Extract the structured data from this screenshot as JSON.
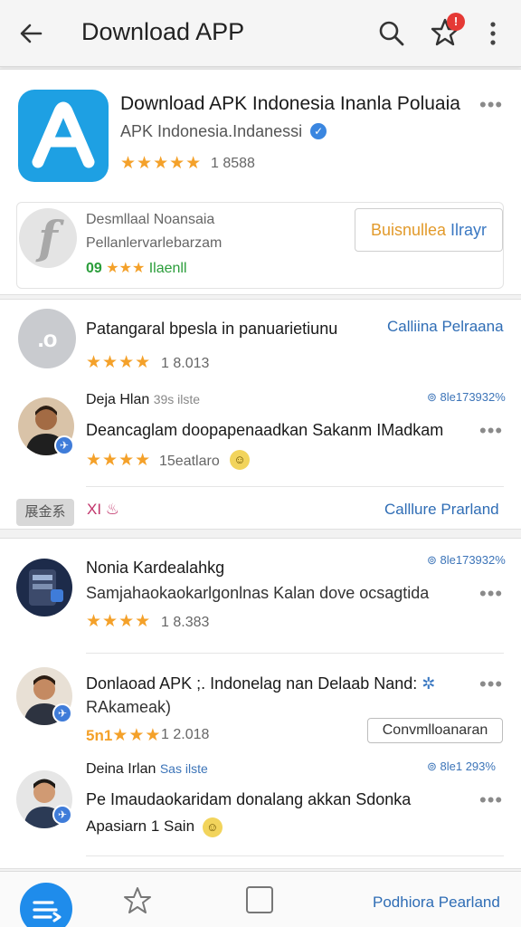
{
  "appbar": {
    "title": "Download APP",
    "notification_badge": "!"
  },
  "featured": {
    "title": "Download APK Indonesia Inanla Poluaia",
    "publisher": "APK Indonesia.Indanessi",
    "rating_stars": "★★★★★",
    "rating_count": "1 8588",
    "icon_letter": "A"
  },
  "promo": {
    "line1": "Desmllaal Noansaia",
    "line2": "Pellanlervarlebarzam",
    "rating_prefix": "09",
    "rating_stars": "★★★",
    "rating_suffix": "Ilaenll",
    "icon_letter": "f",
    "button_label_orange": "Buisnullea",
    "button_label_blue": "Ilrayr"
  },
  "section2": {
    "icon_text": ".o",
    "title": "Patangaral bpesla in panuarietiunu",
    "link": "Calliina Pelraana",
    "rating_stars": "★★★★",
    "rating_count": "1 8.013",
    "post": {
      "author": "Deja Hlan",
      "author_meta": "39s ilste",
      "stat": "⊚ 8le173932%",
      "text": "Deancaglam doopapenaadkan Sakanm IMadkam",
      "rating_stars": "★★★★",
      "rating_count": "15eatlaro"
    },
    "tag_label": "展金系",
    "tag_text": "XI",
    "footer_link": "Calllure Prarland"
  },
  "section3": {
    "items": [
      {
        "title": "Nonia Kardealahkg",
        "stat": "⊚ 8le173932%",
        "text": "Samjahaokaokarlgonlnas Kalan dove ocsagtida",
        "rating_stars": "★★★★",
        "rating_count": "1 8.383"
      },
      {
        "title": "Donlaoad APK ;. Indonelag nan Delaab Nand:",
        "subtitle": "RAkameak)",
        "rating_prefix": "5n1",
        "rating_stars": "★★★",
        "rating_count": "1 2.018",
        "button_label": "Convmlloanaran"
      },
      {
        "author": "Deina Irlan",
        "author_meta": "Sas ilste",
        "stat": "⊚ 8le1 293%",
        "text": "Pe Imaudaokaridam donalang akkan Sdonka",
        "subtext": "Apasiarn 1 Sain"
      }
    ]
  },
  "bottombar": {
    "link": "Podhiora Pearland"
  },
  "colors": {
    "accent": "#1ea0e3",
    "link": "#2f6db5",
    "star": "#f4a12a",
    "badge": "#e53935"
  }
}
